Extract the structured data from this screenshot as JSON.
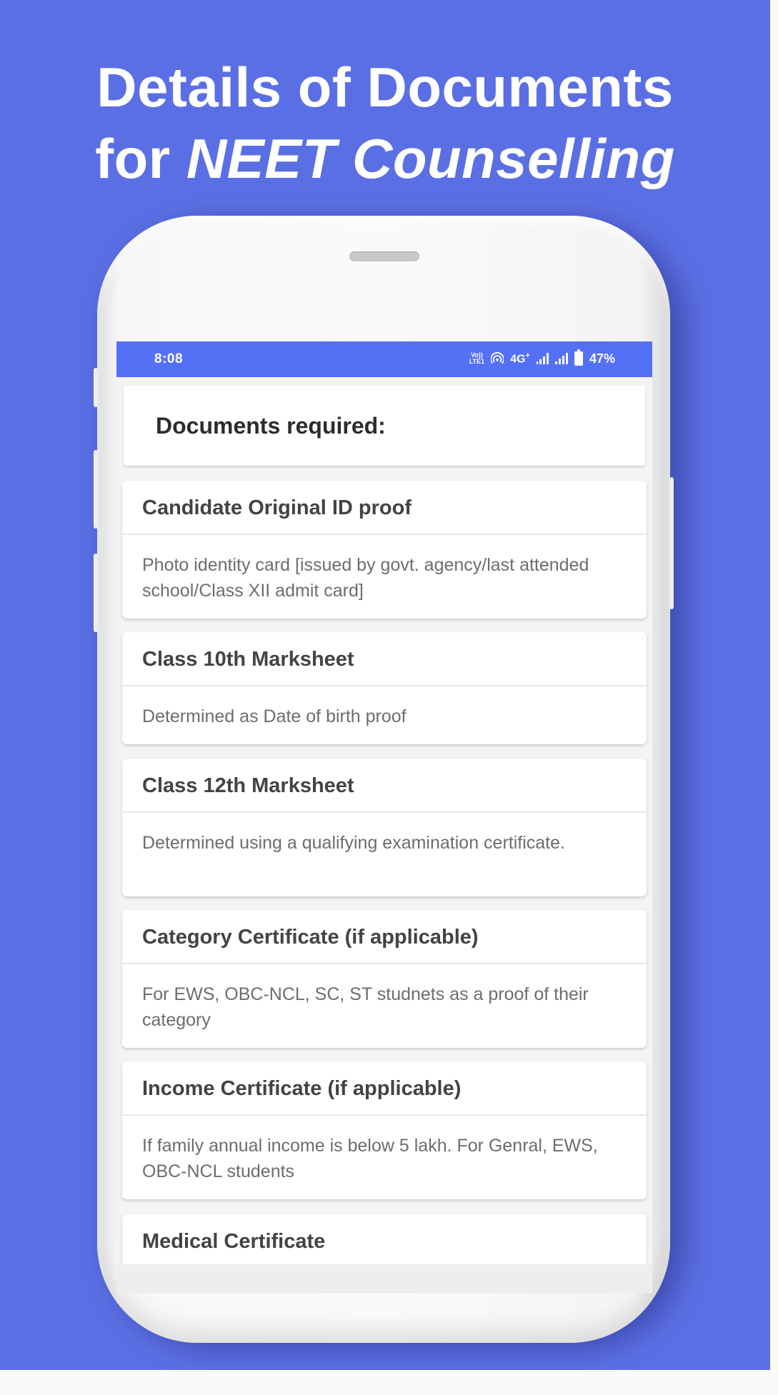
{
  "headline": {
    "line1": "Details of Documents",
    "line2_prefix": "for ",
    "line2_emphasis": "NEET Counselling"
  },
  "colors": {
    "background": "#5b6fe4",
    "status_bar": "#5470f5",
    "card": "#ffffff",
    "title_text": "#434343",
    "body_text": "#6d6d6d"
  },
  "status_bar": {
    "time": "8:08",
    "volte_label_top": "Vo))",
    "volte_label_bottom": "LTE1",
    "network_type": "4G",
    "network_suffix": "+",
    "battery_percent": "47%",
    "icons": [
      "volte-icon",
      "hotspot-icon",
      "signal-icon-sim1",
      "signal-icon-sim2",
      "battery-icon"
    ]
  },
  "screen": {
    "heading": "Documents required:",
    "documents": [
      {
        "title": "Candidate Original ID proof",
        "description": "Photo identity card [issued by govt. agency/last attended school/Class XII admit card]"
      },
      {
        "title": "Class 10th Marksheet",
        "description": "Determined as Date of birth proof"
      },
      {
        "title": "Class 12th Marksheet",
        "description": "Determined using a qualifying examination certificate."
      },
      {
        "title": "Category Certificate (if applicable)",
        "description": "For EWS, OBC-NCL, SC, ST studnets as a proof of their category"
      },
      {
        "title": "Income Certificate (if applicable)",
        "description": "If family annual income is below 5 lakh. For Genral, EWS, OBC-NCL students"
      },
      {
        "title": "Medical Certificate",
        "description": ""
      }
    ]
  }
}
